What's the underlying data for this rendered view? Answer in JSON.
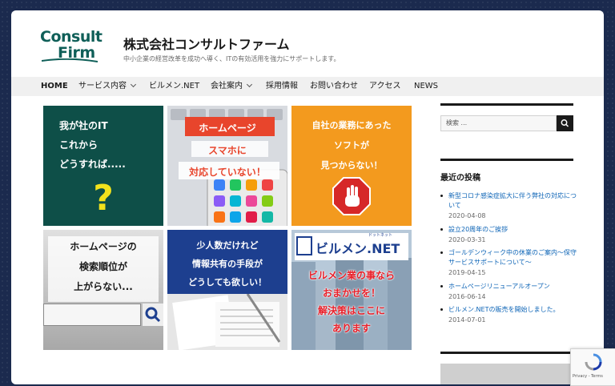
{
  "header": {
    "logo_line1": "Consult",
    "logo_line2": "Firm",
    "site_title": "株式会社コンサルトファーム",
    "site_description": "中小企業の経営改革を成功へ導く、ITの有効活用を強力にサポートします。"
  },
  "nav": {
    "items": [
      {
        "label": "HOME",
        "has_submenu": false
      },
      {
        "label": "サービス内容",
        "has_submenu": true
      },
      {
        "label": "ビルメン.NET",
        "has_submenu": false
      },
      {
        "label": "会社案内",
        "has_submenu": true
      },
      {
        "label": "採用情報",
        "has_submenu": false
      },
      {
        "label": "お問い合わせ",
        "has_submenu": false
      },
      {
        "label": "アクセス",
        "has_submenu": false
      },
      {
        "label": "NEWS",
        "has_submenu": false
      }
    ]
  },
  "tiles": [
    {
      "lines": [
        "我が社のIT",
        "これから",
        "どうすれば....."
      ],
      "mark": "?"
    },
    {
      "lines": [
        "ホームページ",
        "スマホに",
        "対応していない！"
      ]
    },
    {
      "lines": [
        "自社の業務にあった",
        "ソフトが",
        "見つからない！"
      ]
    },
    {
      "lines": [
        "ホームページの",
        "検索順位が",
        "上がらない..."
      ]
    },
    {
      "lines": [
        "少人数だけれど",
        "情報共有の手段が",
        "どうしても欲しい！"
      ]
    },
    {
      "logo": "ビルメン.NET",
      "logo_ruby": "ドットネット",
      "lines": [
        "ビルメン業の事なら",
        "おまかせを！",
        "解決策はここに",
        "あります"
      ]
    }
  ],
  "sidebar": {
    "search_placeholder": "検索 ...",
    "recent_posts_title": "最近の投稿",
    "recent_posts": [
      {
        "title": "新型コロナ感染症拡大に伴う弊社の対応について",
        "date": "2020-04-08"
      },
      {
        "title": "設立20周年のご挨拶",
        "date": "2020-03-31"
      },
      {
        "title": "ゴールデンウィーク中の休業のご案内～保守サービスサポートについて～",
        "date": "2019-04-15"
      },
      {
        "title": "ホームページリニューアルオープン",
        "date": "2016-06-14"
      },
      {
        "title": "ビルメン.NETの販売を開始しました。",
        "date": "2014-07-01"
      }
    ]
  },
  "recaptcha": {
    "links": "Privacy - Terms"
  },
  "colors": {
    "background": "#1b2a4e",
    "logo": "#0f5f58",
    "link": "#0b63b6",
    "tile1": "#0e4f48",
    "tile3": "#f39a1e",
    "tile5": "#1d3f8f"
  }
}
